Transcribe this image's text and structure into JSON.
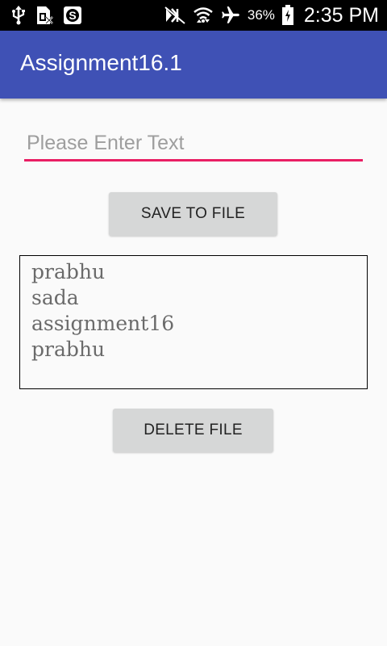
{
  "status_bar": {
    "battery_percent": "36%",
    "time": "2:35 PM",
    "icons": [
      "usb-icon",
      "sim-icon",
      "s-app-icon",
      "nfc-mute-icon",
      "wifi-icon",
      "airplane-icon",
      "battery-icon"
    ]
  },
  "app_bar": {
    "title": "Assignment16.1",
    "color": "#3f51b5"
  },
  "input": {
    "placeholder": "Please Enter Text",
    "value": "",
    "underline_color": "#e91e63"
  },
  "buttons": {
    "save_label": "SAVE TO FILE",
    "delete_label": "DELETE FILE"
  },
  "file_content": {
    "lines": [
      "prabhu",
      "sada",
      "assignment16",
      "prabhu"
    ]
  }
}
